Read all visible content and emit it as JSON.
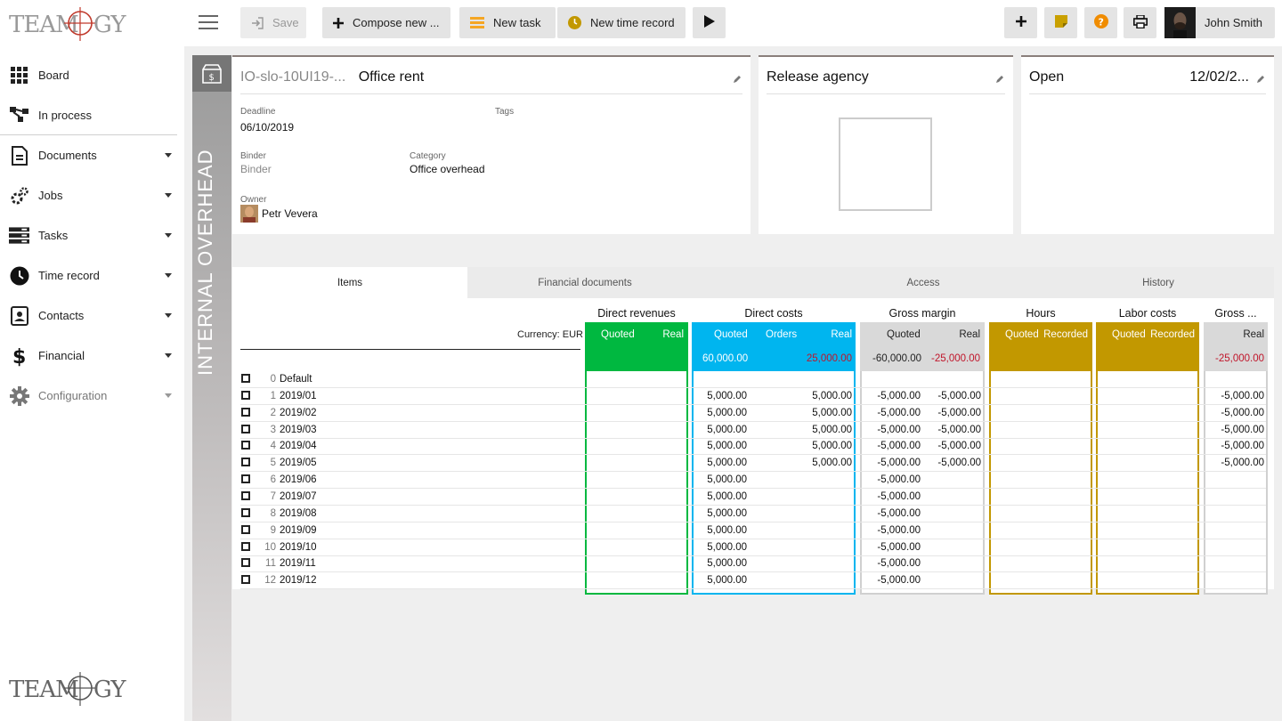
{
  "brand": {
    "logo_text": "TEAMOGY"
  },
  "sidebar": {
    "items": [
      {
        "label": "Board",
        "icon": "grid-icon",
        "has_caret": false
      },
      {
        "label": "In process",
        "icon": "process-icon",
        "has_caret": false
      },
      {
        "label": "Documents",
        "icon": "document-icon",
        "has_caret": true
      },
      {
        "label": "Jobs",
        "icon": "jobs-icon",
        "has_caret": true
      },
      {
        "label": "Tasks",
        "icon": "tasks-icon",
        "has_caret": true
      },
      {
        "label": "Time record",
        "icon": "clock-icon",
        "has_caret": true
      },
      {
        "label": "Contacts",
        "icon": "contacts-icon",
        "has_caret": true
      },
      {
        "label": "Financial",
        "icon": "dollar-icon",
        "has_caret": true
      },
      {
        "label": "Configuration",
        "icon": "gear-icon",
        "has_caret": true
      }
    ]
  },
  "toolbar": {
    "save_label": "Save",
    "compose_label": "Compose new ...",
    "new_task_label": "New task",
    "new_time_record_label": "New time record",
    "user_name": "John Smith",
    "colors": {
      "task_orange": "#f5a623",
      "clock_gold": "#c29800",
      "note_gold": "#c9a000",
      "help_orange": "#f08c00"
    }
  },
  "job": {
    "side_label": "INTERNAL OVERHEAD",
    "code": "IO-slo-10UI19-...",
    "name": "Office rent",
    "deadline_label": "Deadline",
    "deadline_value": "06/10/2019",
    "tags_label": "Tags",
    "binder_label": "Binder",
    "binder_value": "Binder",
    "category_label": "Category",
    "category_value": "Office overhead",
    "owner_label": "Owner",
    "owner_value": "Petr Vevera",
    "agency_title": "Release agency",
    "status_title": "Open",
    "status_date": "12/02/2..."
  },
  "tabs": [
    "Items",
    "Financial documents",
    "Access",
    "History"
  ],
  "table": {
    "currency_label": "Currency: EUR",
    "groups": {
      "direct_revenues": {
        "title": "Direct revenues",
        "cols": [
          "Quoted",
          "Real"
        ],
        "color": "#00b840"
      },
      "direct_costs": {
        "title": "Direct costs",
        "cols": [
          "Quoted",
          "Orders",
          "Real"
        ],
        "color": "#00b5ef",
        "total_quoted": "60,000.00",
        "total_real": "25,000.00"
      },
      "gross_margin": {
        "title": "Gross margin",
        "cols": [
          "Quoted",
          "Real"
        ],
        "color": "#d9d9d9",
        "total_quoted": "-60,000.00",
        "total_real": "-25,000.00"
      },
      "hours": {
        "title": "Hours",
        "cols": [
          "Quoted",
          "Recorded"
        ],
        "color": "#c29800"
      },
      "labor_costs": {
        "title": "Labor costs",
        "cols": [
          "Quoted",
          "Recorded"
        ],
        "color": "#c29800"
      },
      "gross_last": {
        "title": "Gross ...",
        "cols": [
          "Real"
        ],
        "color": "#d9d9d9",
        "total_real": "-25,000.00"
      }
    },
    "rows": [
      {
        "num": "0",
        "name": "Default",
        "dc_quoted": "",
        "dc_real": "",
        "gm_quoted": "",
        "gm_real": "",
        "g2_real": ""
      },
      {
        "num": "1",
        "name": "2019/01",
        "dc_quoted": "5,000.00",
        "dc_real": "5,000.00",
        "gm_quoted": "-5,000.00",
        "gm_real": "-5,000.00",
        "g2_real": "-5,000.00"
      },
      {
        "num": "2",
        "name": "2019/02",
        "dc_quoted": "5,000.00",
        "dc_real": "5,000.00",
        "gm_quoted": "-5,000.00",
        "gm_real": "-5,000.00",
        "g2_real": "-5,000.00"
      },
      {
        "num": "3",
        "name": "2019/03",
        "dc_quoted": "5,000.00",
        "dc_real": "5,000.00",
        "gm_quoted": "-5,000.00",
        "gm_real": "-5,000.00",
        "g2_real": "-5,000.00"
      },
      {
        "num": "4",
        "name": "2019/04",
        "dc_quoted": "5,000.00",
        "dc_real": "5,000.00",
        "gm_quoted": "-5,000.00",
        "gm_real": "-5,000.00",
        "g2_real": "-5,000.00"
      },
      {
        "num": "5",
        "name": "2019/05",
        "dc_quoted": "5,000.00",
        "dc_real": "5,000.00",
        "gm_quoted": "-5,000.00",
        "gm_real": "-5,000.00",
        "g2_real": "-5,000.00"
      },
      {
        "num": "6",
        "name": "2019/06",
        "dc_quoted": "5,000.00",
        "dc_real": "",
        "gm_quoted": "-5,000.00",
        "gm_real": "",
        "g2_real": ""
      },
      {
        "num": "7",
        "name": "2019/07",
        "dc_quoted": "5,000.00",
        "dc_real": "",
        "gm_quoted": "-5,000.00",
        "gm_real": "",
        "g2_real": ""
      },
      {
        "num": "8",
        "name": "2019/08",
        "dc_quoted": "5,000.00",
        "dc_real": "",
        "gm_quoted": "-5,000.00",
        "gm_real": "",
        "g2_real": ""
      },
      {
        "num": "9",
        "name": "2019/09",
        "dc_quoted": "5,000.00",
        "dc_real": "",
        "gm_quoted": "-5,000.00",
        "gm_real": "",
        "g2_real": ""
      },
      {
        "num": "10",
        "name": "2019/10",
        "dc_quoted": "5,000.00",
        "dc_real": "",
        "gm_quoted": "-5,000.00",
        "gm_real": "",
        "g2_real": ""
      },
      {
        "num": "11",
        "name": "2019/11",
        "dc_quoted": "5,000.00",
        "dc_real": "",
        "gm_quoted": "-5,000.00",
        "gm_real": "",
        "g2_real": ""
      },
      {
        "num": "12",
        "name": "2019/12",
        "dc_quoted": "5,000.00",
        "dc_real": "",
        "gm_quoted": "-5,000.00",
        "gm_real": "",
        "g2_real": ""
      }
    ]
  }
}
